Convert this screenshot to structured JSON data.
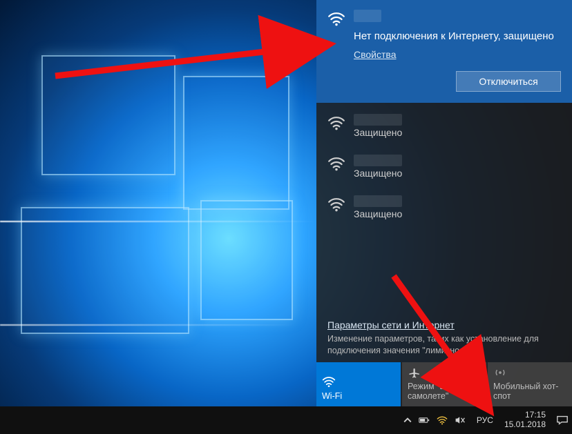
{
  "current_network": {
    "ssid": "",
    "status": "Нет подключения к Интернету, защищено",
    "properties_label": "Свойства",
    "disconnect_label": "Отключиться"
  },
  "networks": [
    {
      "ssid": "",
      "security": "Защищено"
    },
    {
      "ssid": "",
      "security": "Защищено"
    },
    {
      "ssid": "",
      "security": "Защищено"
    }
  ],
  "settings": {
    "link": "Параметры сети и Интернет",
    "hint": "Изменение параметров, таких как установление для подключения значения \"лимитное\""
  },
  "tiles": {
    "wifi": "Wi-Fi",
    "airplane": "Режим \"в самолете\"",
    "hotspot": "Мобильный хот-спот"
  },
  "tray": {
    "language": "РУС",
    "time": "17:15",
    "date": "15.01.2018"
  }
}
